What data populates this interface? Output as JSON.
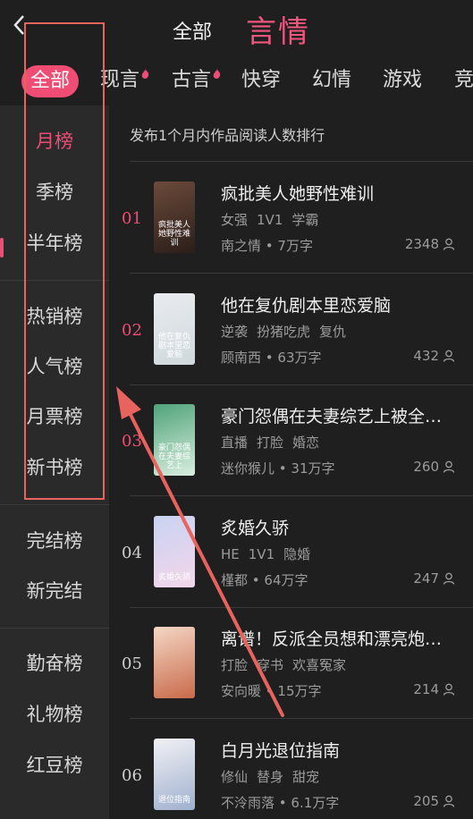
{
  "header": {
    "all_label": "全部",
    "title": "言情"
  },
  "categories": [
    {
      "label": "全部",
      "active": true,
      "hot": false
    },
    {
      "label": "现言",
      "active": false,
      "hot": true
    },
    {
      "label": "古言",
      "active": false,
      "hot": true
    },
    {
      "label": "快穿",
      "active": false,
      "hot": false
    },
    {
      "label": "幻情",
      "active": false,
      "hot": false
    },
    {
      "label": "游戏",
      "active": false,
      "hot": false
    },
    {
      "label": "竞",
      "active": false,
      "hot": false
    }
  ],
  "sidebar": {
    "items": [
      {
        "label": "月榜",
        "active": true
      },
      {
        "label": "季榜",
        "active": false
      },
      {
        "label": "半年榜",
        "active": false
      },
      {
        "label": "热销榜",
        "active": false
      },
      {
        "label": "人气榜",
        "active": false
      },
      {
        "label": "月票榜",
        "active": false
      },
      {
        "label": "新书榜",
        "active": false
      },
      {
        "label": "完结榜",
        "active": false
      },
      {
        "label": "新完结",
        "active": false
      },
      {
        "label": "勤奋榜",
        "active": false
      },
      {
        "label": "礼物榜",
        "active": false
      },
      {
        "label": "红豆榜",
        "active": false
      }
    ]
  },
  "ranking": {
    "subtitle": "发布1个月内作品阅读人数排行",
    "books": [
      {
        "rank": "01",
        "title": "疯批美人她野性难训",
        "tags": [
          "女强",
          "1V1",
          "学霸"
        ],
        "author": "南之情",
        "words": "7万字",
        "reads": "2348",
        "cover_colors": [
          "#6b4a3a",
          "#2b1e1a"
        ],
        "cover_text": "疯批美人她野性难训"
      },
      {
        "rank": "02",
        "title": "他在复仇剧本里恋爱脑",
        "tags": [
          "逆袭",
          "扮猪吃虎",
          "复仇"
        ],
        "author": "顾南西",
        "words": "63万字",
        "reads": "432",
        "cover_colors": [
          "#e9ecef",
          "#cfd8dc"
        ],
        "cover_text": "他在复仇剧本里恋爱脑"
      },
      {
        "rank": "03",
        "title": "豪门怨偶在夫妻综艺上被全网嗑疯",
        "tags": [
          "直播",
          "打脸",
          "婚恋"
        ],
        "author": "迷你猴儿",
        "words": "31万字",
        "reads": "260",
        "cover_colors": [
          "#4fa37a",
          "#d9eedf"
        ],
        "cover_text": "豪门怨偶在夫妻综艺上"
      },
      {
        "rank": "04",
        "title": "炙婚久骄",
        "tags": [
          "HE",
          "1V1",
          "隐婚"
        ],
        "author": "槿都",
        "words": "64万字",
        "reads": "247",
        "cover_colors": [
          "#c9d3f2",
          "#f3d6ea"
        ],
        "cover_text": "炙婚久骄"
      },
      {
        "rank": "05",
        "title": "离谱！反派全员想和漂亮炮灰贴贴",
        "tags": [
          "打脸",
          "穿书",
          "欢喜冤家"
        ],
        "author": "安向暖",
        "words": "15万字",
        "reads": "214",
        "cover_colors": [
          "#f4d7c5",
          "#c96a4a"
        ],
        "cover_text": ""
      },
      {
        "rank": "06",
        "title": "白月光退位指南",
        "tags": [
          "修仙",
          "替身",
          "甜宠"
        ],
        "author": "不泠雨落",
        "words": "6.1万字",
        "reads": "205",
        "cover_colors": [
          "#f1f1f4",
          "#9fb0cf"
        ],
        "cover_text": "退位指南"
      }
    ]
  },
  "colors": {
    "accent": "#ef4d74",
    "background": "#1f1f20",
    "sidebar": "#2a2a2b",
    "annotation": "#e8635d"
  }
}
